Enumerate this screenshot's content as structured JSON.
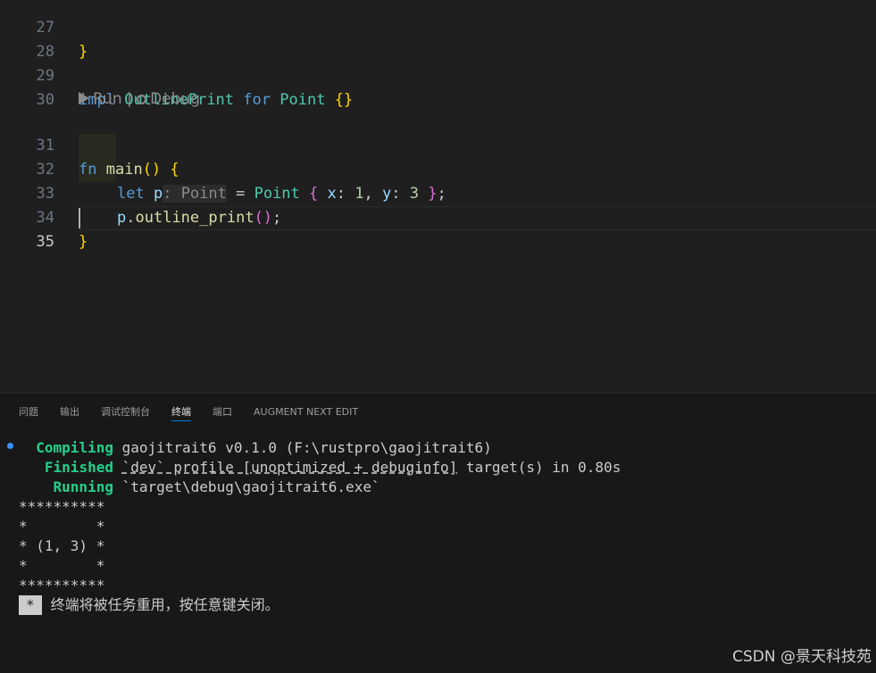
{
  "editor": {
    "lines": {
      "l27": {
        "num": "27",
        "brace": "}"
      },
      "l28": {
        "num": "28"
      },
      "l29": {
        "num": "29",
        "kw_impl": "impl",
        "trait": "OutlinePrint",
        "kw_for": "for",
        "type": "Point",
        "braces": "{}"
      },
      "l30": {
        "num": "30"
      },
      "l31": {
        "num": "31",
        "kw_fn": "fn",
        "fn_name": "main",
        "parens": "()",
        "brace_open": "{"
      },
      "l32": {
        "num": "32",
        "kw_let": "let",
        "var": "p",
        "hint": ": Point",
        "eq": " = ",
        "type": "Point",
        "brace_open": "{",
        "field_x": "x",
        "colon1": ":",
        "val_x": "1",
        "comma": ",",
        "field_y": "y",
        "colon2": ":",
        "val_y": "3",
        "brace_close": "}",
        "semi": ";"
      },
      "l33": {
        "num": "33",
        "var": "p",
        "dot": ".",
        "method": "outline_print",
        "parens": "()",
        "semi": ";"
      },
      "l34": {
        "num": "34",
        "brace": "}"
      },
      "l35": {
        "num": "35"
      }
    },
    "codelens": {
      "run": "Run",
      "separator": " | ",
      "debug": "Debug"
    },
    "colors": {
      "keyword": "#569cd6",
      "type": "#4ec9b0",
      "function": "#dcdcaa",
      "variable": "#9cdcfe",
      "number": "#b5cea8",
      "bracket1": "#ffd700",
      "bracket2": "#da70d6"
    }
  },
  "panel": {
    "tabs": [
      "问题",
      "输出",
      "调试控制台",
      "终端",
      "端口",
      "AUGMENT NEXT EDIT"
    ],
    "active_tab": "终端"
  },
  "terminal": {
    "compiling_label": "Compiling",
    "compiling_text": " gaojitrait6 v0.1.0 (F:\\rustpro\\gaojitrait6)",
    "finished_label": "Finished",
    "finished_pre": " ",
    "finished_ul": "`dev` profile [unoptimized + debuginfo]",
    "finished_post": " target(s) in 0.80s",
    "running_label": "Running",
    "running_text": " `target\\debug\\gaojitrait6.exe`",
    "output": [
      "**********",
      "*        *",
      "* (1, 3) *",
      "*        *",
      "**********"
    ],
    "reuse_badge": "*",
    "reuse_msg": "终端将被任务重用，按任意键关闭。"
  },
  "watermark": "CSDN @景天科技苑"
}
